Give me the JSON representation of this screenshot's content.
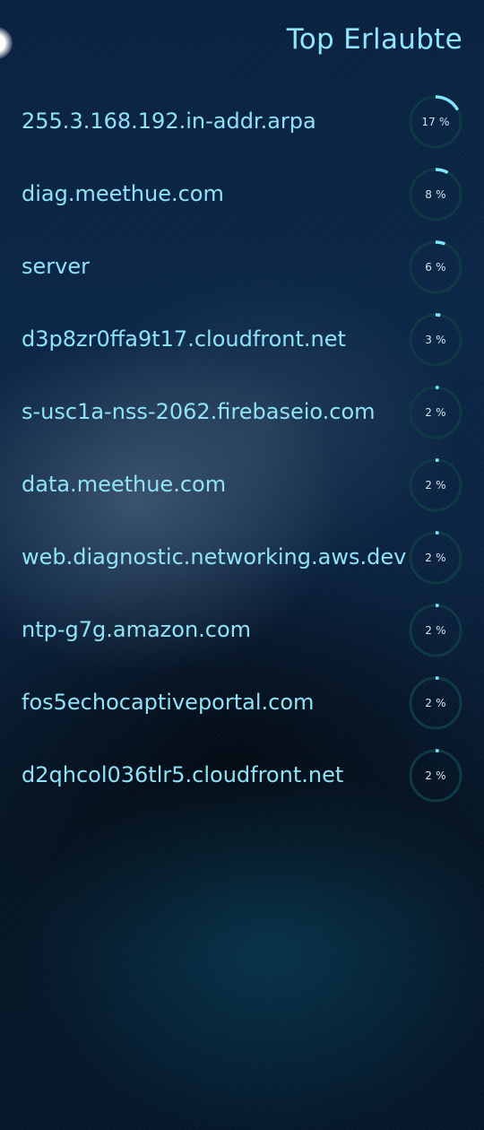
{
  "header": {
    "title": "Top Erlaubte"
  },
  "colors": {
    "accent": "#8fe6ff",
    "gauge_track": "#0f3a45",
    "gauge_fill": "#7fe7ff"
  },
  "domains": [
    {
      "name": "255.3.168.192.in-addr.arpa",
      "percent_label": "17 %",
      "fraction": 0.17
    },
    {
      "name": "diag.meethue.com",
      "percent_label": "8 %",
      "fraction": 0.08
    },
    {
      "name": "server",
      "percent_label": "6 %",
      "fraction": 0.06
    },
    {
      "name": "d3p8zr0ffa9t17.cloudfront.net",
      "percent_label": "3 %",
      "fraction": 0.03
    },
    {
      "name": "s-usc1a-nss-2062.firebaseio.com",
      "percent_label": "2 %",
      "fraction": 0.02
    },
    {
      "name": "data.meethue.com",
      "percent_label": "2 %",
      "fraction": 0.02
    },
    {
      "name": "web.diagnostic.networking.aws.dev",
      "percent_label": "2 %",
      "fraction": 0.02
    },
    {
      "name": "ntp-g7g.amazon.com",
      "percent_label": "2 %",
      "fraction": 0.02
    },
    {
      "name": "fos5echocaptiveportal.com",
      "percent_label": "2 %",
      "fraction": 0.02
    },
    {
      "name": "d2qhcol036tlr5.cloudfront.net",
      "percent_label": "2 %",
      "fraction": 0.02
    }
  ]
}
